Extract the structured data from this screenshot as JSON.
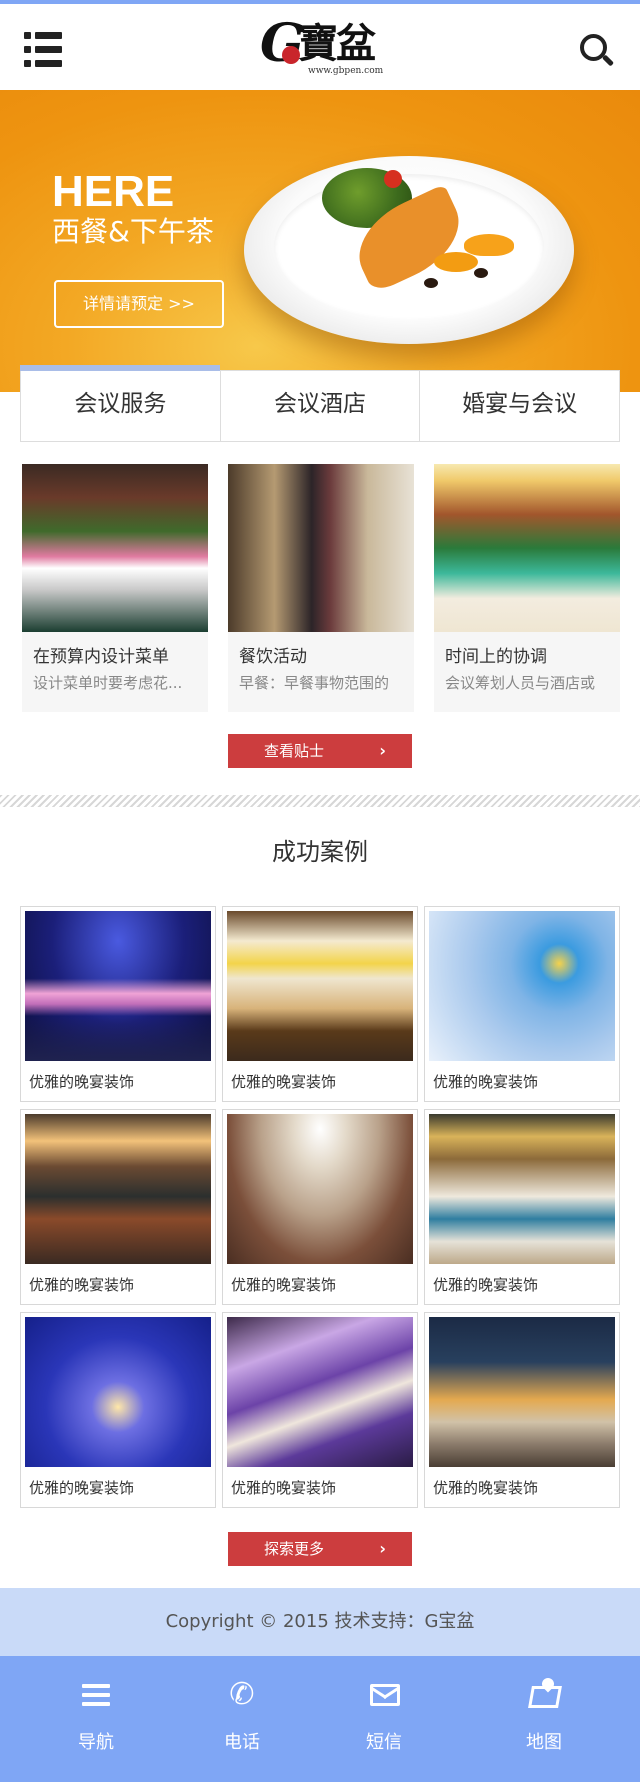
{
  "header": {
    "logo_letter": "G",
    "logo_chinese": "寶盆",
    "logo_url": "www.gbpen.com",
    "icons": {
      "menu": "menu-list-icon",
      "search": "search-icon"
    }
  },
  "banner": {
    "title": "HERE",
    "subtitle": "西餐&下午茶",
    "button_label": "详情请预定  >>"
  },
  "tabs": [
    {
      "label": "会议服务"
    },
    {
      "label": "会议酒店"
    },
    {
      "label": "婚宴与会议"
    }
  ],
  "tips": {
    "items": [
      {
        "title": "在预算内设计菜单",
        "desc": "设计菜单时要考虑花..."
      },
      {
        "title": "餐饮活动",
        "desc": "早餐：早餐事物范围的"
      },
      {
        "title": "时间上的协调",
        "desc": "会议筹划人员与酒店或"
      }
    ],
    "button_label": "查看贴士",
    "button_arrow": "›"
  },
  "cases": {
    "title": "成功案例",
    "items": [
      {
        "caption": "优雅的晚宴装饰"
      },
      {
        "caption": "优雅的晚宴装饰"
      },
      {
        "caption": "优雅的晚宴装饰"
      },
      {
        "caption": "优雅的晚宴装饰"
      },
      {
        "caption": "优雅的晚宴装饰"
      },
      {
        "caption": "优雅的晚宴装饰"
      },
      {
        "caption": "优雅的晚宴装饰"
      },
      {
        "caption": "优雅的晚宴装饰"
      },
      {
        "caption": "优雅的晚宴装饰"
      }
    ],
    "button_label": "探索更多",
    "button_arrow": "›"
  },
  "footer": {
    "copyright": "Copyright  © 2015 技术支持：G宝盆"
  },
  "bottom_nav": [
    {
      "label": "导航",
      "icon": "menu-icon"
    },
    {
      "label": "电话",
      "icon": "phone-icon"
    },
    {
      "label": "短信",
      "icon": "mail-icon"
    },
    {
      "label": "地图",
      "icon": "map-icon"
    }
  ],
  "colors": {
    "accent_blue": "#7fa6f5",
    "footer_light_blue": "#c9daf8",
    "button_red": "#cc3d3e",
    "banner_orange": "#ee9410"
  }
}
